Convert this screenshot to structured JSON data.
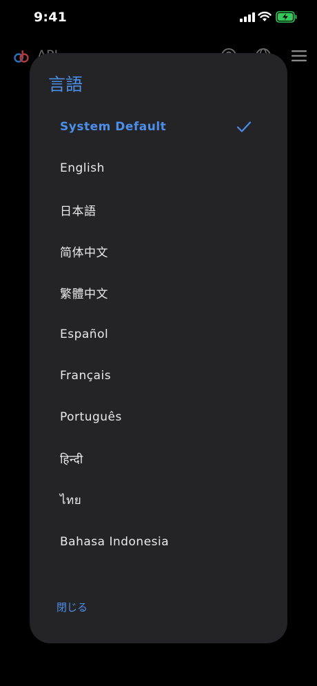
{
  "status_bar": {
    "time": "9:41"
  },
  "background_header": {
    "title": "API",
    "icons": [
      "app-logo",
      "account-icon",
      "globe-icon",
      "menu-icon"
    ]
  },
  "sheet": {
    "title": "言語",
    "languages": [
      {
        "label": "System Default",
        "selected": true
      },
      {
        "label": "English",
        "selected": false
      },
      {
        "label": "日本語",
        "selected": false
      },
      {
        "label": "简体中文",
        "selected": false
      },
      {
        "label": "繁體中文",
        "selected": false
      },
      {
        "label": "Español",
        "selected": false
      },
      {
        "label": "Français",
        "selected": false
      },
      {
        "label": "Português",
        "selected": false
      },
      {
        "label": "हिन्दी",
        "selected": false
      },
      {
        "label": "ไทย",
        "selected": false
      },
      {
        "label": "Bahasa Indonesia",
        "selected": false
      }
    ],
    "close_label": "閉じる"
  },
  "colors": {
    "accent": "#4c8eea",
    "sheet_background": "#242426",
    "page_background": "#000000",
    "battery_green": "#34c759"
  }
}
